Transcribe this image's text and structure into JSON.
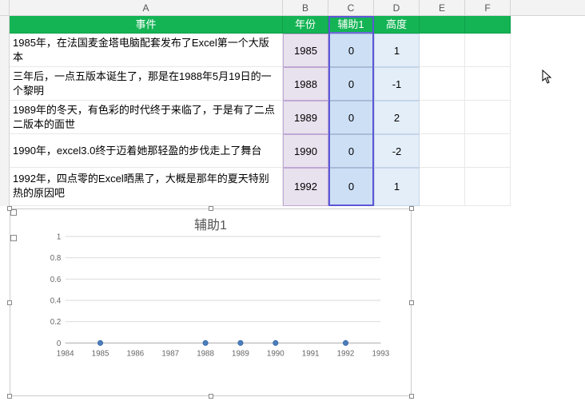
{
  "columns": {
    "A": "A",
    "B": "B",
    "C": "C",
    "D": "D",
    "E": "E",
    "F": "F"
  },
  "headers": {
    "event": "事件",
    "year": "年份",
    "aux1": "辅助1",
    "height": "高度"
  },
  "rows": [
    {
      "event": "1985年，在法国麦金塔电脑配套发布了Excel第一个大版本",
      "year": "1985",
      "aux": "0",
      "h": "1"
    },
    {
      "event": "三年后，一点五版本诞生了，那是在1988年5月19日的一个黎明",
      "year": "1988",
      "aux": "0",
      "h": "-1"
    },
    {
      "event": "1989年的冬天，有色彩的时代终于来临了，于是有了二点二版本的面世",
      "year": "1989",
      "aux": "0",
      "h": "2"
    },
    {
      "event": "1990年，excel3.0终于迈着她那轻盈的步伐走上了舞台",
      "year": "1990",
      "aux": "0",
      "h": "-2"
    },
    {
      "event": "1992年，四点零的Excel晒黑了，大概是那年的夏天特别热的原因吧",
      "year": "1992",
      "aux": "0",
      "h": "1"
    }
  ],
  "chart_data": {
    "type": "scatter",
    "title": "辅助1",
    "xlabel": "",
    "ylabel": "",
    "xlim": [
      1984,
      1993
    ],
    "ylim": [
      0,
      1
    ],
    "xticks": [
      1984,
      1985,
      1986,
      1987,
      1988,
      1989,
      1990,
      1991,
      1992,
      1993
    ],
    "yticks": [
      0,
      0.2,
      0.4,
      0.6,
      0.8,
      1
    ],
    "series": [
      {
        "name": "辅助1",
        "x": [
          1985,
          1988,
          1989,
          1990,
          1992
        ],
        "y": [
          0,
          0,
          0,
          0,
          0
        ]
      }
    ],
    "grid": true
  }
}
